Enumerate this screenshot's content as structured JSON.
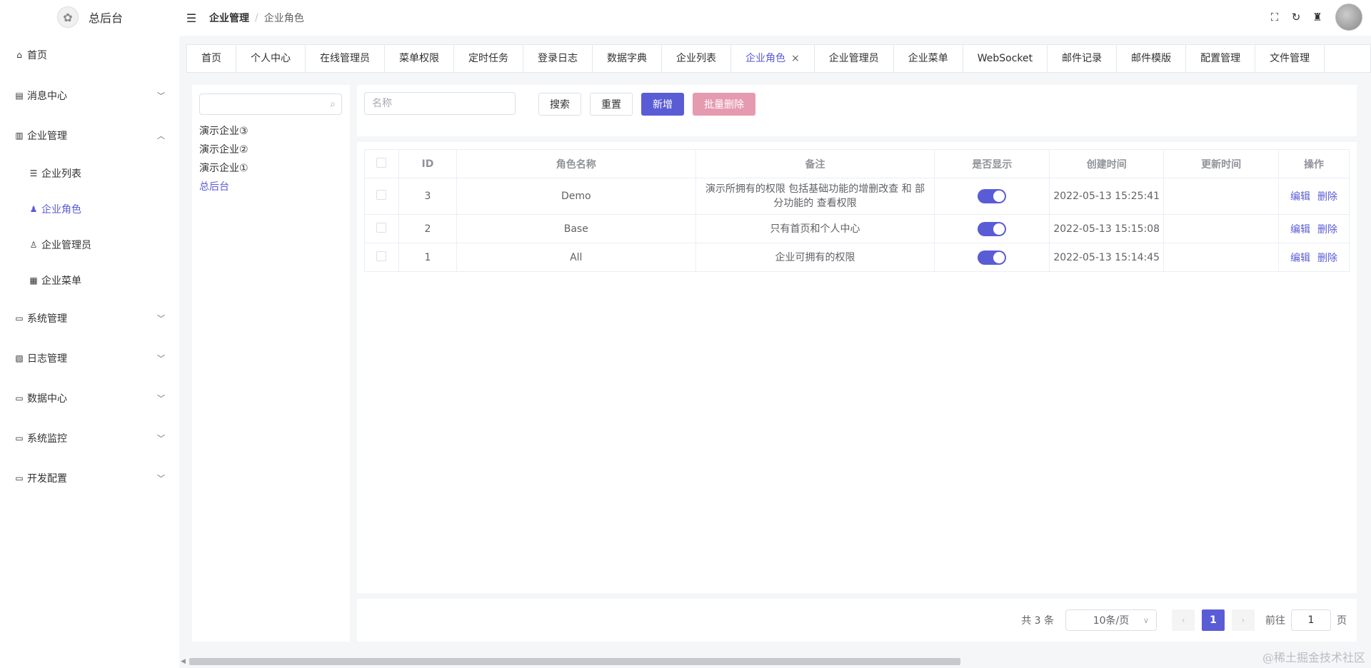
{
  "app": {
    "title": "总后台"
  },
  "sidebar": {
    "items": [
      {
        "label": "首页",
        "icon": "home-icon",
        "glyph": "⌂"
      },
      {
        "label": "消息中心",
        "icon": "message-icon",
        "glyph": "▤",
        "expandable": true
      },
      {
        "label": "企业管理",
        "icon": "building-icon",
        "glyph": "▥",
        "expandable": true,
        "expanded": true,
        "children": [
          {
            "label": "企业列表",
            "icon": "list-icon",
            "glyph": "☰"
          },
          {
            "label": "企业角色",
            "icon": "users-icon",
            "glyph": "♟",
            "active": true
          },
          {
            "label": "企业管理员",
            "icon": "user-icon",
            "glyph": "♙"
          },
          {
            "label": "企业菜单",
            "icon": "grid-icon",
            "glyph": "▦"
          }
        ]
      },
      {
        "label": "系统管理",
        "icon": "monitor-icon",
        "glyph": "▭",
        "expandable": true
      },
      {
        "label": "日志管理",
        "icon": "log-icon",
        "glyph": "▧",
        "expandable": true
      },
      {
        "label": "数据中心",
        "icon": "monitor-icon",
        "glyph": "▭",
        "expandable": true
      },
      {
        "label": "系统监控",
        "icon": "monitor-icon",
        "glyph": "▭",
        "expandable": true
      },
      {
        "label": "开发配置",
        "icon": "monitor-icon",
        "glyph": "▭",
        "expandable": true
      }
    ]
  },
  "header": {
    "breadcrumb": [
      "企业管理",
      "企业角色"
    ],
    "separator": "/"
  },
  "tabs": [
    {
      "label": "首页"
    },
    {
      "label": "个人中心"
    },
    {
      "label": "在线管理员"
    },
    {
      "label": "菜单权限"
    },
    {
      "label": "定时任务"
    },
    {
      "label": "登录日志"
    },
    {
      "label": "数据字典"
    },
    {
      "label": "企业列表"
    },
    {
      "label": "企业角色",
      "active": true
    },
    {
      "label": "企业管理员"
    },
    {
      "label": "企业菜单"
    },
    {
      "label": "WebSocket"
    },
    {
      "label": "邮件记录"
    },
    {
      "label": "邮件模版"
    },
    {
      "label": "配置管理"
    },
    {
      "label": "文件管理"
    }
  ],
  "tree": {
    "search_placeholder": "",
    "nodes": [
      {
        "label": "演示企业③"
      },
      {
        "label": "演示企业②"
      },
      {
        "label": "演示企业①"
      },
      {
        "label": "总后台",
        "current": true
      }
    ]
  },
  "search": {
    "name_placeholder": "名称",
    "search_label": "搜索",
    "reset_label": "重置",
    "add_label": "新增",
    "batch_delete_label": "批量删除"
  },
  "table": {
    "columns": [
      "ID",
      "角色名称",
      "备注",
      "是否显示",
      "创建时间",
      "更新时间",
      "操作"
    ],
    "rows": [
      {
        "id": "3",
        "name": "Demo",
        "remark": "演示所拥有的权限 包括基础功能的增删改查 和 部分功能的 查看权限",
        "shown": true,
        "created": "2022-05-13 15:25:41",
        "updated": ""
      },
      {
        "id": "2",
        "name": "Base",
        "remark": "只有首页和个人中心",
        "shown": true,
        "created": "2022-05-13 15:15:08",
        "updated": ""
      },
      {
        "id": "1",
        "name": "All",
        "remark": "企业可拥有的权限",
        "shown": true,
        "created": "2022-05-13 15:14:45",
        "updated": ""
      }
    ],
    "edit_label": "编辑",
    "delete_label": "删除"
  },
  "pager": {
    "total": "共 3 条",
    "page_size": "10条/页",
    "current_page": "1",
    "goto_label": "前往",
    "goto_value": "1",
    "page_unit": "页"
  },
  "watermark": "@稀土掘金技术社区",
  "colors": {
    "accent": "#5a5cd6",
    "danger_light": "#e59aaf"
  }
}
